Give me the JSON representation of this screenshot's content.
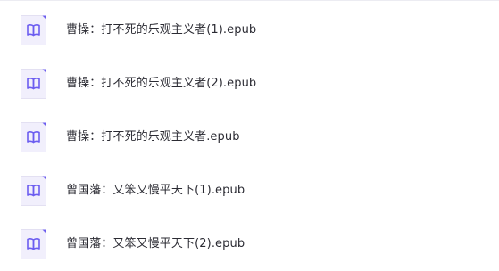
{
  "file_list": {
    "items": [
      {
        "name": "曹操：打不死的乐观主义者(1).epub",
        "icon": "epub-book-icon"
      },
      {
        "name": "曹操：打不死的乐观主义者(2).epub",
        "icon": "epub-book-icon"
      },
      {
        "name": "曹操：打不死的乐观主义者.epub",
        "icon": "epub-book-icon"
      },
      {
        "name": "曾国藩：又笨又慢平天下(1).epub",
        "icon": "epub-book-icon"
      },
      {
        "name": "曾国藩：又笨又慢平天下(2).epub",
        "icon": "epub-book-icon"
      }
    ]
  },
  "colors": {
    "icon_accent": "#6b5cf0",
    "icon_background": "#f1effc",
    "icon_border": "#e3e0f2",
    "text": "#2b2b33"
  }
}
